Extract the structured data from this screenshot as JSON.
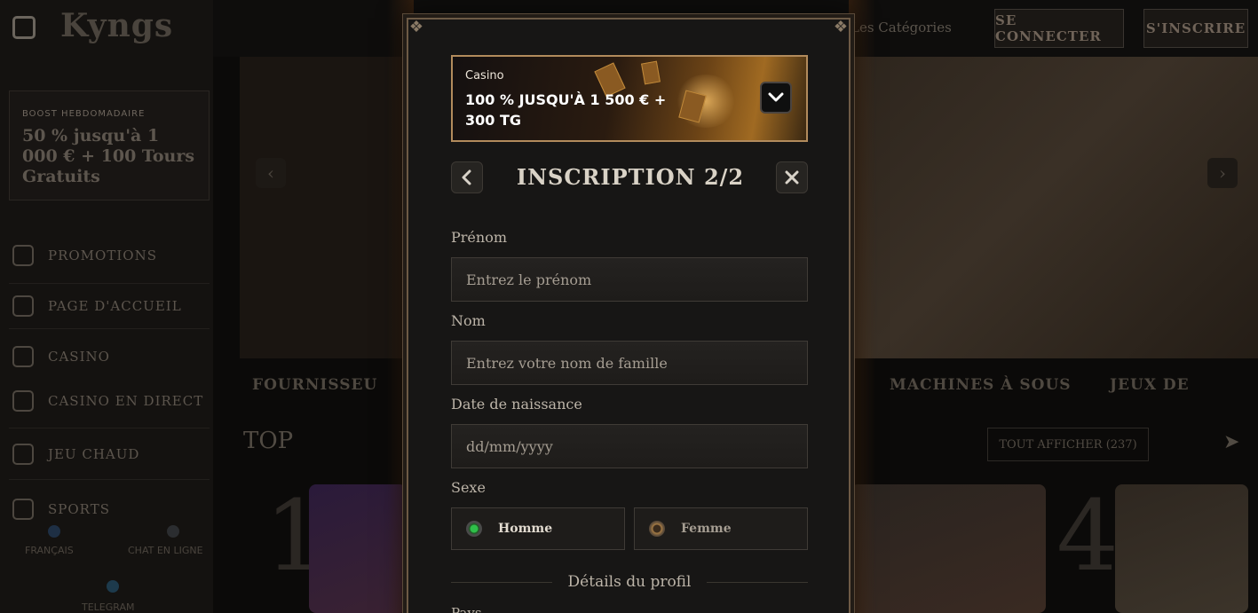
{
  "background": {
    "logo": "Kyngs",
    "boost": {
      "title": "BOOST HEBDOMADAIRE",
      "text": "50 % jusqu'à 1 000 € + 100 Tours Gratuits"
    },
    "sidebar": [
      {
        "label": "PROMOTIONS",
        "icon": "gift-icon"
      },
      {
        "label": "PAGE D'ACCUEIL",
        "icon": "home-icon"
      },
      {
        "label": "CASINO",
        "icon": "casino-icon"
      },
      {
        "label": "CASINO EN DIRECT",
        "icon": "cards-icon"
      },
      {
        "label": "JEU CHAUD",
        "icon": "fire-icon"
      },
      {
        "label": "SPORTS",
        "icon": "ball-icon"
      }
    ],
    "lang": "FRANÇAIS",
    "chat": "CHAT EN LIGNE",
    "telegram": "TELEGRAM",
    "categories_link": "Les Catégories",
    "login": "SE CONNECTER",
    "signup": "S'INSCRIRE",
    "providers": "FOURNISSEU",
    "slots": "MACHINES À SOUS",
    "games": "JEUX DE",
    "top": "TOP",
    "see_all": "TOUT AFFICHER (237)",
    "ranks": [
      "1",
      "4"
    ]
  },
  "modal": {
    "banner": {
      "label": "Casino",
      "offer": "100 % JUSQU'À 1 500 € + 300 TG"
    },
    "title": "INSCRIPTION 2/2",
    "fields": {
      "first_name": {
        "label": "Prénom",
        "placeholder": "Entrez le prénom"
      },
      "last_name": {
        "label": "Nom",
        "placeholder": "Entrez votre nom de famille"
      },
      "birthdate": {
        "label": "Date de naissance",
        "placeholder": "dd/mm/yyyy"
      }
    },
    "gender": {
      "label": "Sexe",
      "options": [
        {
          "label": "Homme",
          "selected": true
        },
        {
          "label": "Femme",
          "selected": false
        }
      ]
    },
    "section": "Détails du profil",
    "country_label": "Pays"
  }
}
